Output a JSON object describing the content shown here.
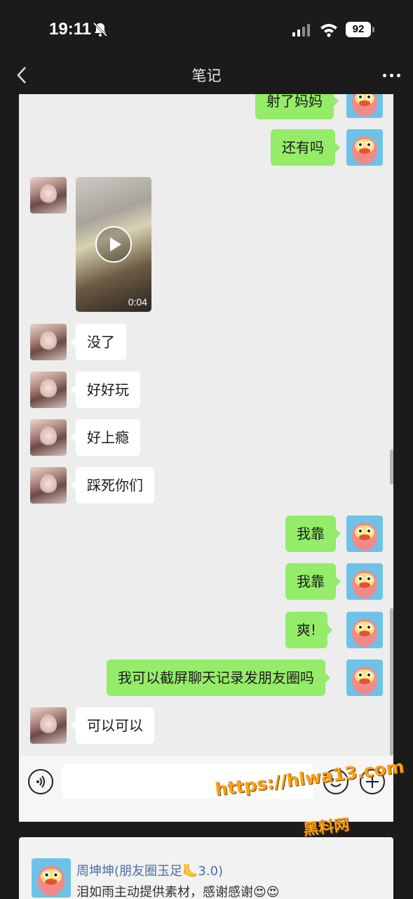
{
  "status_bar": {
    "time": "19:11",
    "battery": "92"
  },
  "nav": {
    "title": "笔记"
  },
  "messages": {
    "out_1": "射了妈妈",
    "out_2": "还有吗",
    "video_duration": "0:04",
    "in_1": "没了",
    "in_2": "好好玩",
    "in_3": "好上瘾",
    "in_4": "踩死你们",
    "out_3": "我靠",
    "out_4": "我靠",
    "out_5": "爽!",
    "out_6": "我可以截屏聊天记录发朋友圈吗",
    "in_5": "可以可以"
  },
  "watermark": {
    "url": "https://hlwa13.com",
    "site": "黑料网"
  },
  "comment": {
    "name": "周坤坤(朋友圈玉足🦶3.0)",
    "text": "泪如雨主动提供素材，感谢感谢😍😍"
  },
  "colors": {
    "outgoing_bubble": "#95ec69",
    "incoming_bubble": "#ffffff",
    "chat_bg": "#ededed",
    "watermark": "#f8a417"
  }
}
